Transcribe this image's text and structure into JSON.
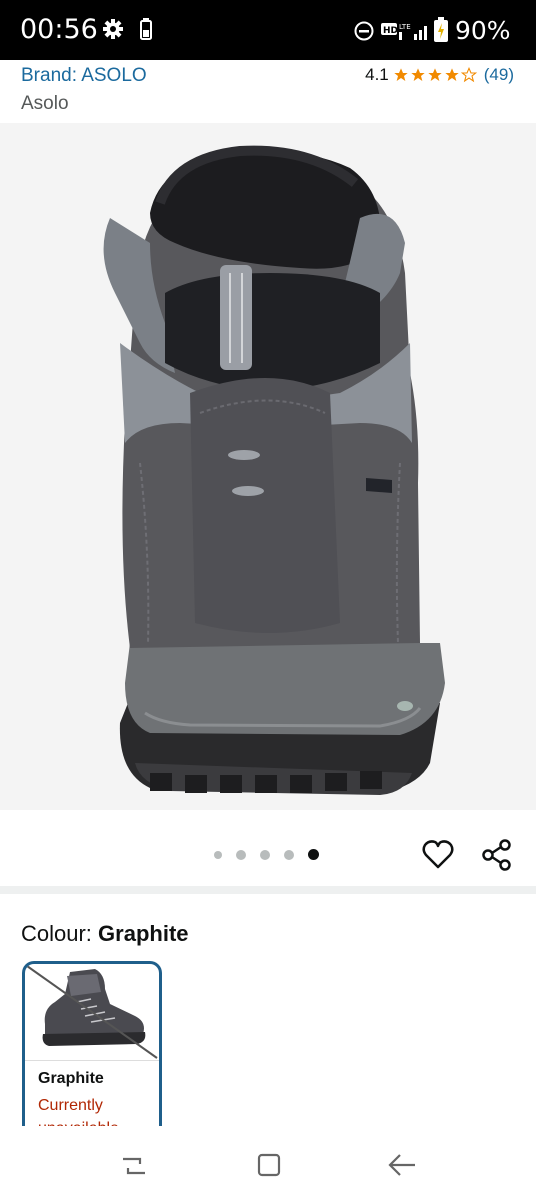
{
  "status_bar": {
    "time": "00:56",
    "battery_percent": "90%",
    "icons": [
      "gear-icon",
      "battery-small-icon",
      "do-not-disturb-icon",
      "hd-lte-signal-icon",
      "battery-icon"
    ]
  },
  "product": {
    "brand_link": "Brand: ASOLO",
    "manufacturer": "Asolo",
    "rating_value": "4.1",
    "rating_count": "(49)",
    "star_fill": 4.1,
    "star_color": "#f18a00"
  },
  "gallery": {
    "image_icon": "boot-rear-view-image",
    "dot_count": 5,
    "active_dot_index": 5
  },
  "actions": {
    "favorite_icon": "heart-icon",
    "share_icon": "share-icon"
  },
  "colour": {
    "label": "Colour: ",
    "selected": "Graphite",
    "swatches": [
      {
        "name": "Graphite",
        "status": "Currently unavailable",
        "image_icon": "boot-thumbnail-crossed"
      }
    ],
    "accent": "#1f5f8b",
    "unavailable_color": "#b12704"
  },
  "nav_bar": {
    "icons": [
      "recent-apps-icon",
      "home-icon",
      "back-icon"
    ]
  }
}
